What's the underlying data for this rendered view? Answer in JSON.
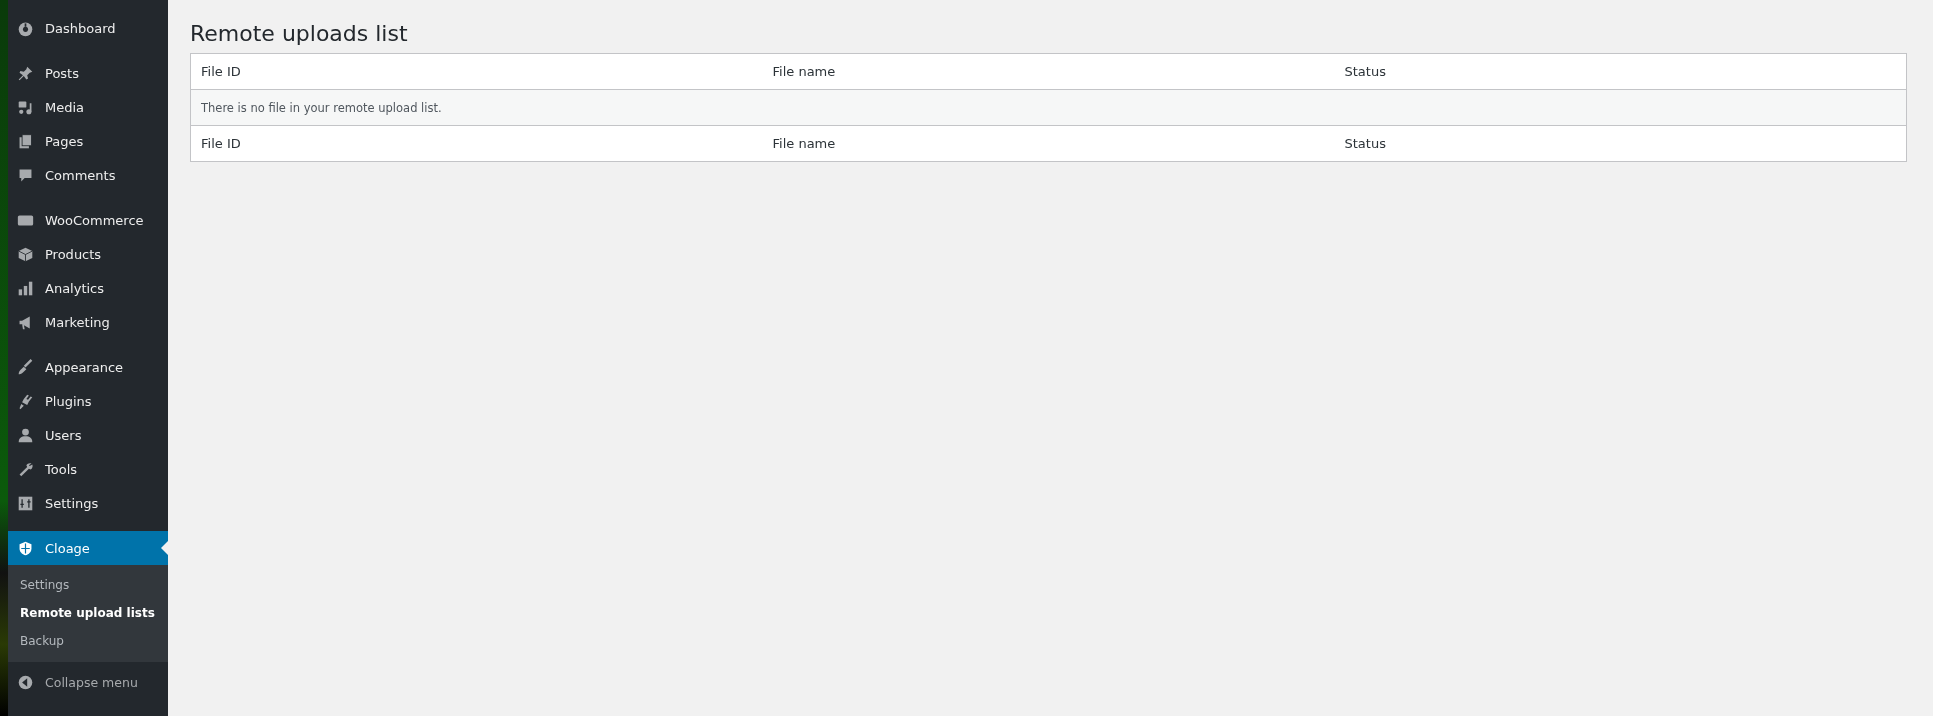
{
  "sidebar": {
    "groups": [
      {
        "items": [
          {
            "label": "Dashboard",
            "selected": false
          }
        ]
      },
      {
        "items": [
          {
            "label": "Posts",
            "selected": false
          },
          {
            "label": "Media",
            "selected": false
          },
          {
            "label": "Pages",
            "selected": false
          },
          {
            "label": "Comments",
            "selected": false
          }
        ]
      },
      {
        "items": [
          {
            "label": "WooCommerce",
            "selected": false
          },
          {
            "label": "Products",
            "selected": false
          },
          {
            "label": "Analytics",
            "selected": false
          },
          {
            "label": "Marketing",
            "selected": false
          }
        ]
      },
      {
        "items": [
          {
            "label": "Appearance",
            "selected": false
          },
          {
            "label": "Plugins",
            "selected": false
          },
          {
            "label": "Users",
            "selected": false
          },
          {
            "label": "Tools",
            "selected": false
          },
          {
            "label": "Settings",
            "selected": false
          }
        ]
      },
      {
        "items": [
          {
            "label": "Cloage",
            "selected": true,
            "children": [
              {
                "label": "Settings",
                "selected": false
              },
              {
                "label": "Remote upload lists",
                "selected": true
              },
              {
                "label": "Backup",
                "selected": false
              }
            ]
          }
        ]
      }
    ],
    "collapse": "Collapse menu"
  },
  "page": {
    "title": "Remote uploads list",
    "table": {
      "columns": [
        "File ID",
        "File name",
        "Status"
      ],
      "empty_message": "There is no file in your remote upload list.",
      "footer_columns": [
        "File ID",
        "File name",
        "Status"
      ]
    }
  }
}
